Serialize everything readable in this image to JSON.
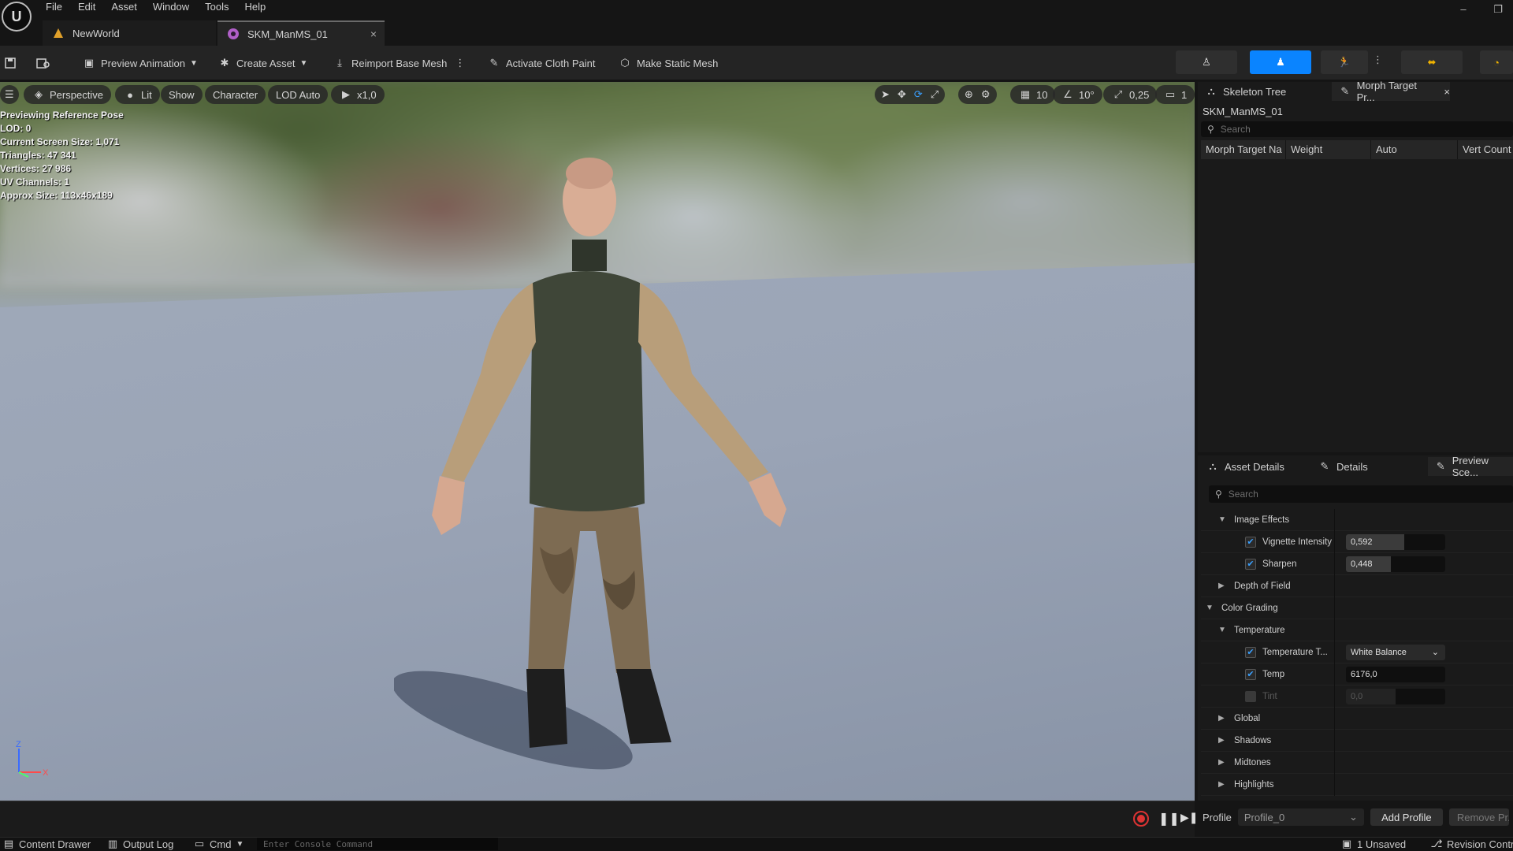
{
  "app": {
    "menu": [
      "File",
      "Edit",
      "Asset",
      "Window",
      "Tools",
      "Help"
    ],
    "tabs": [
      {
        "label": "NewWorld",
        "icon": "level-icon"
      },
      {
        "label": "SKM_ManMS_01",
        "icon": "skeletal-mesh-icon",
        "close": "×"
      }
    ]
  },
  "toolbar": {
    "preview_animation": "Preview Animation",
    "create_asset": "Create Asset",
    "reimport": "Reimport Base Mesh",
    "cloth_paint": "Activate Cloth Paint",
    "static_mesh": "Make Static Mesh"
  },
  "viewport": {
    "perspective": "Perspective",
    "lit": "Lit",
    "show": "Show",
    "character": "Character",
    "lod": "LOD Auto",
    "speed": "x1,0",
    "grid_snap": "10",
    "rot_snap": "10°",
    "scale_snap": "0,25",
    "camera_speed": "1",
    "stats": [
      "Previewing Reference Pose",
      "LOD: 0",
      "Current Screen Size: 1,071",
      "Triangles: 47 341",
      "Vertices: 27 986",
      "UV Channels: 1",
      "Approx Size: 113x46x189"
    ],
    "axis": {
      "z": "Z",
      "x": "X"
    }
  },
  "skeleton_panel": {
    "tab1": "Skeleton Tree",
    "tab2": "Morph Target Pr...",
    "close": "×",
    "mesh_name": "SKM_ManMS_01",
    "search_placeholder": "Search",
    "columns": [
      "Morph Target Na",
      "Weight",
      "Auto",
      "Vert Count"
    ]
  },
  "details_panel": {
    "tabs": [
      "Asset Details",
      "Details",
      "Preview Sce..."
    ],
    "search_placeholder": "Search",
    "image_effects": "Image Effects",
    "vignette": {
      "label": "Vignette Intensity",
      "value": "0,592",
      "fraction": 0.59
    },
    "sharpen": {
      "label": "Sharpen",
      "value": "0,448",
      "fraction": 0.45
    },
    "depth_of_field": "Depth of Field",
    "color_grading": "Color Grading",
    "temperature": "Temperature",
    "temp_type": {
      "label": "Temperature T...",
      "value": "White Balance"
    },
    "temp": {
      "label": "Temp",
      "value": "6176,0"
    },
    "tint": {
      "label": "Tint",
      "value": "0,0"
    },
    "global": "Global",
    "shadows": "Shadows",
    "midtones": "Midtones",
    "highlights": "Highlights",
    "profile_label": "Profile",
    "profile_value": "Profile_0",
    "add_profile": "Add Profile",
    "remove_profile": "Remove Pr..."
  },
  "statusbar": {
    "content_drawer": "Content Drawer",
    "output_log": "Output Log",
    "cmd": "Cmd",
    "console_placeholder": "Enter Console Command",
    "unsaved": "1 Unsaved",
    "revision": "Revision Contr..."
  },
  "colors": {
    "accent": "#0a84ff",
    "panel": "#1a1a1a"
  }
}
